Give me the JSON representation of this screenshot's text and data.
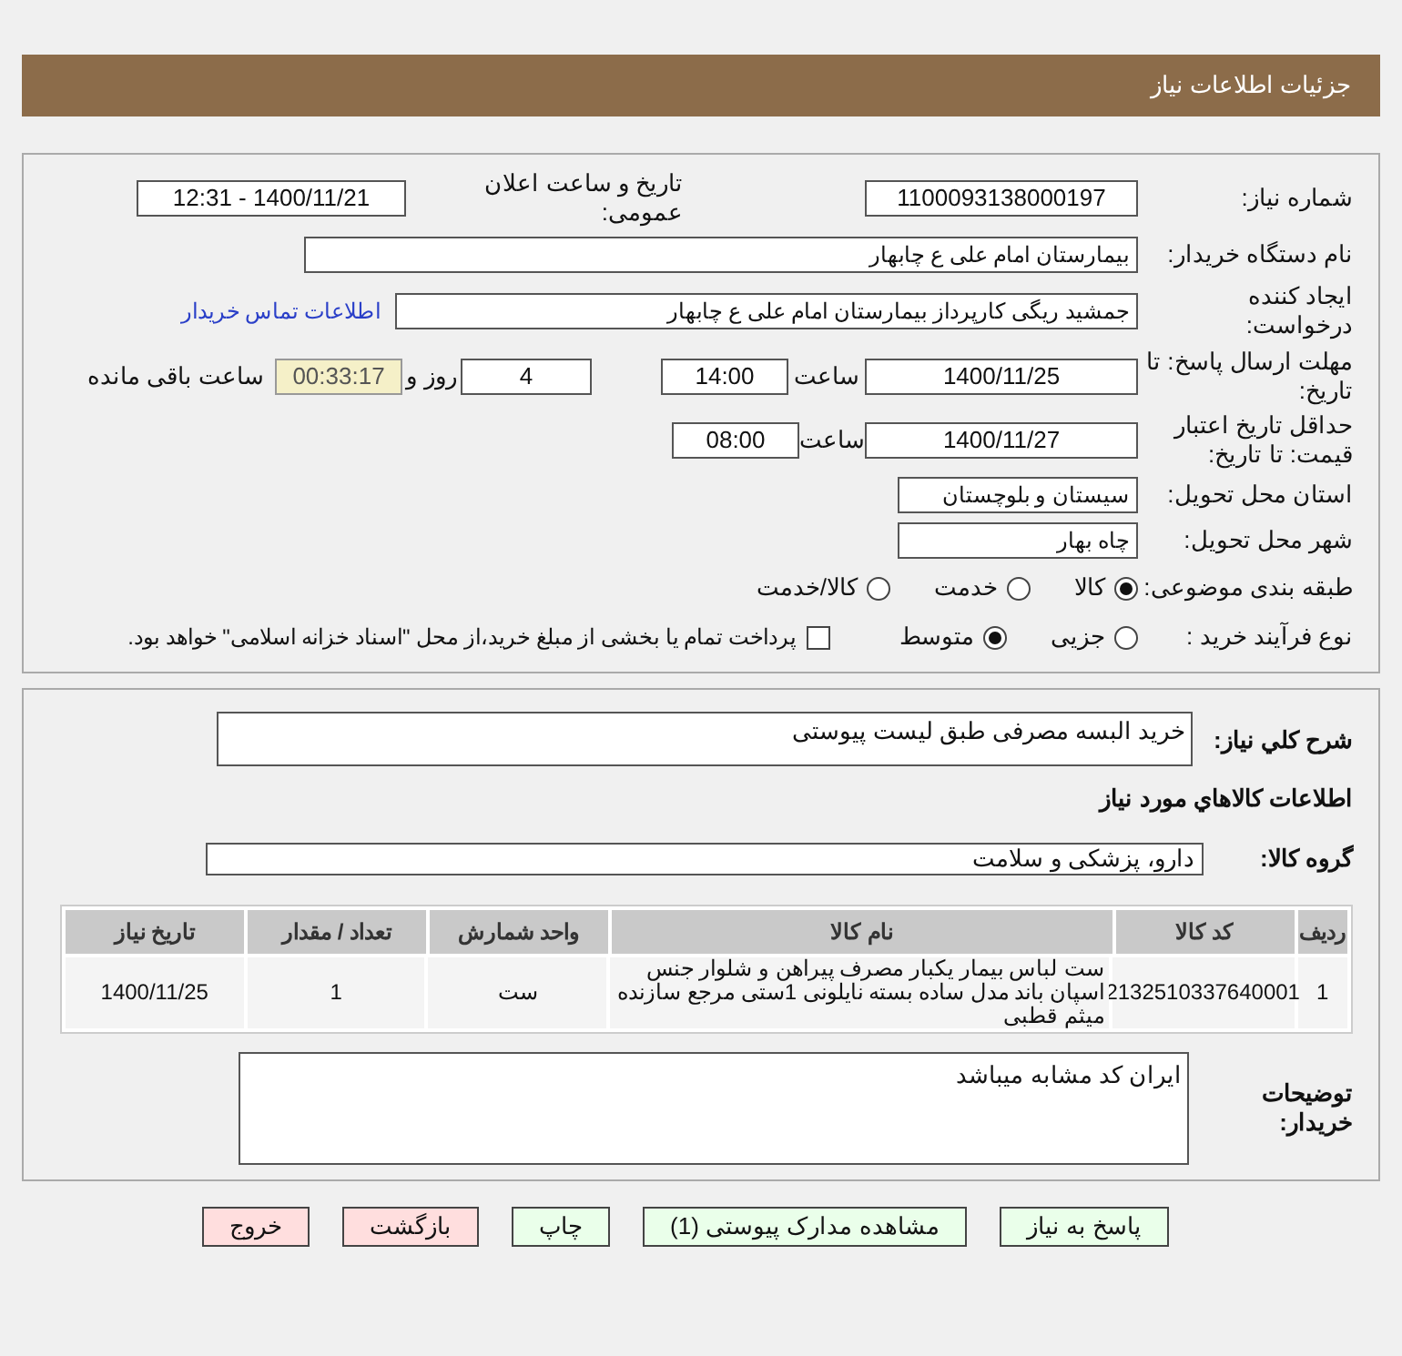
{
  "header": {
    "title": "جزئیات اطلاعات نیاز"
  },
  "need_number": {
    "label": "شماره نیاز:",
    "value": "1100093138000197"
  },
  "announce": {
    "label": "تاریخ و ساعت اعلان عمومی:",
    "value": "1400/11/21 - 12:31"
  },
  "buyer_org": {
    "label": "نام دستگاه خریدار:",
    "value": "بیمارستان امام علی  ع  چابهار"
  },
  "requester": {
    "label": "ایجاد کننده درخواست:",
    "value": "جمشید ریگی کارپرداز بیمارستان امام علی  ع  چابهار",
    "link": "اطلاعات تماس خریدار"
  },
  "deadline": {
    "label": "مهلت ارسال پاسخ: تا تاریخ:",
    "date": "1400/11/25",
    "time_label": "ساعت",
    "time": "14:00",
    "days": "4",
    "days_label": "روز و",
    "remaining": "00:33:17",
    "remaining_label": "ساعت باقی مانده"
  },
  "validity": {
    "label": "حداقل تاریخ اعتبار قیمت: تا تاریخ:",
    "date": "1400/11/27",
    "time_label": "ساعت",
    "time": "08:00"
  },
  "province": {
    "label": "استان محل تحویل:",
    "value": "سیستان و بلوچستان"
  },
  "city": {
    "label": "شهر محل تحویل:",
    "value": "چاه بهار"
  },
  "category": {
    "label": "طبقه بندی موضوعی:",
    "options": [
      {
        "label": "کالا",
        "selected": true
      },
      {
        "label": "خدمت",
        "selected": false
      },
      {
        "label": "کالا/خدمت",
        "selected": false
      }
    ]
  },
  "process": {
    "label": "نوع فرآیند خرید :",
    "options": [
      {
        "label": "جزیی",
        "selected": false
      },
      {
        "label": "متوسط",
        "selected": true
      }
    ],
    "payment_checkbox": {
      "label": "پرداخت تمام یا بخشی از مبلغ خرید،از محل \"اسناد خزانه اسلامی\" خواهد بود.",
      "checked": false
    }
  },
  "description": {
    "label": "شرح كلي نياز:",
    "value": "خرید البسه مصرفی طبق لیست پیوستی"
  },
  "goods_heading": "اطلاعات كالاهاي مورد نياز",
  "goods_group": {
    "label": "گروه کالا:",
    "value": "دارو، پزشکی و سلامت"
  },
  "table": {
    "columns": [
      "ردیف",
      "کد کالا",
      "نام کالا",
      "واحد شمارش",
      "تعداد / مقدار",
      "تاریخ نیاز"
    ],
    "rows": [
      [
        "1",
        "2132510337640001",
        "ست لباس بیمار یکبار مصرف پیراهن و شلوار جنس اسپان باند مدل ساده بسته نایلونی 1ستی مرجع سازنده میثم قطبی",
        "ست",
        "1",
        "1400/11/25"
      ]
    ]
  },
  "buyer_notes": {
    "label": "توضیحات خریدار:",
    "value": "ایران کد مشابه  میباشد"
  },
  "buttons": [
    {
      "label": "پاسخ به نیاز",
      "kind": "action"
    },
    {
      "label": "مشاهده مدارک پیوستی (1)",
      "kind": "action"
    },
    {
      "label": "چاپ",
      "kind": "action"
    },
    {
      "label": "بازگشت",
      "kind": "exit"
    },
    {
      "label": "خروج",
      "kind": "exit"
    }
  ]
}
